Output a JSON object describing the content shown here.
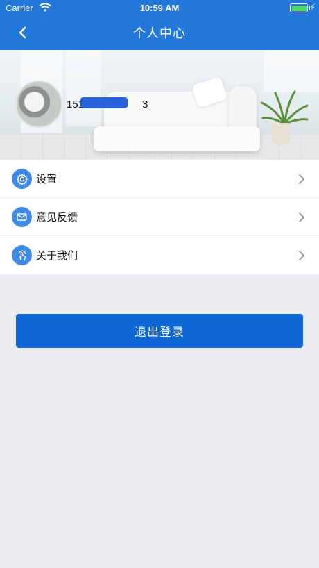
{
  "status_bar": {
    "carrier": "Carrier",
    "time": "10:59 AM",
    "battery_charging": true
  },
  "nav": {
    "title": "个人中心",
    "back_icon": "chevron-left-icon"
  },
  "profile": {
    "phone_prefix": "151",
    "phone_suffix": "3",
    "avatar_icon": "avatar-photo"
  },
  "menu": {
    "items": [
      {
        "label": "设置",
        "icon": "gear-icon"
      },
      {
        "label": "意见反馈",
        "icon": "mail-icon"
      },
      {
        "label": "关于我们",
        "icon": "touch-hand-icon"
      }
    ]
  },
  "logout": {
    "label": "退出登录"
  },
  "colors": {
    "nav_bg": "#2178d8",
    "button_bg": "#0e66d5",
    "icon_bg": "#3f8ae6",
    "page_bg": "#ebedf1"
  }
}
